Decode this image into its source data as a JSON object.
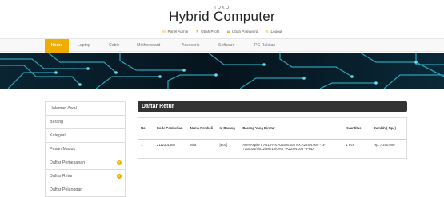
{
  "header": {
    "store_label": "TOKO",
    "store_name": "Hybrid Computer",
    "links": [
      {
        "label": "Panel Admin",
        "icon": "document-icon"
      },
      {
        "label": "Ubah Profil",
        "icon": "user-icon"
      },
      {
        "label": "Ubah Password",
        "icon": "lock-icon"
      },
      {
        "label": "Logout",
        "icon": "power-icon"
      }
    ]
  },
  "nav": {
    "items": [
      "Home",
      "Laptop",
      "Cable",
      "Motherboard",
      "Accesoris",
      "Software",
      "PC Rakitan"
    ],
    "active_color": "#f0ad00"
  },
  "sidebar": {
    "items": [
      {
        "label": "Halaman Awal"
      },
      {
        "label": "Barang"
      },
      {
        "label": "Kategori"
      },
      {
        "label": "Pesan Masuk"
      },
      {
        "label": "Daftar Pemesanan",
        "badge": "!"
      },
      {
        "label": "Daftar Retur",
        "badge": "!"
      },
      {
        "label": "Daftar Pelanggan"
      }
    ]
  },
  "main": {
    "title": "Daftar Retur",
    "columns": [
      "No.",
      "Kode Pembelian",
      "Nama Pembeli",
      "Id Barang",
      "Barang Yang Diretur",
      "Kuantitas",
      "Jumlah ( Rp. )"
    ],
    "rows": [
      [
        "1",
        "2112301468",
        "Nifa",
        "[B01]",
        "Acer Aspire 5 A514-NX.A22SN.008 NX.A22SN.009 - i3-7110024/4/512/Win10/OHS - A22SN.009 - PHD",
        "1 Pcs",
        "Rp. 7,200,000"
      ]
    ]
  }
}
